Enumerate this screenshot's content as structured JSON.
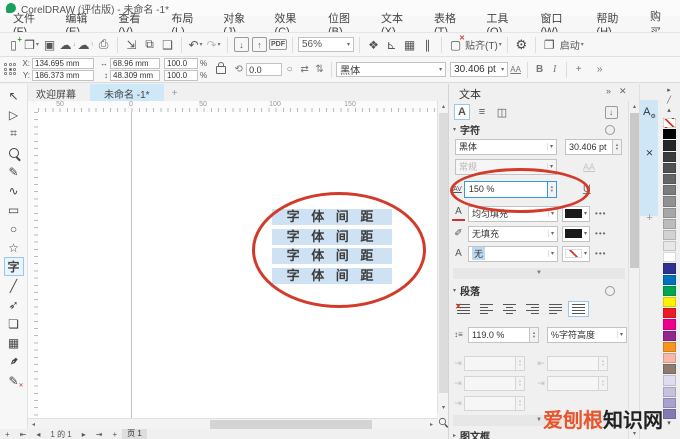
{
  "window": {
    "title": "CorelDRAW (评估版) - 未命名 -1*"
  },
  "menu": [
    "文件(F)",
    "编辑(E)",
    "查看(V)",
    "布局(L)",
    "对象(J)",
    "效果(C)",
    "位图(B)",
    "文本(X)",
    "表格(T)",
    "工具(O)",
    "窗口(W)",
    "帮助(H)",
    "购买"
  ],
  "toolbar": {
    "zoom_level": "56%",
    "snap": "贴齐(T)",
    "launch": "启动",
    "pdf": "PDF"
  },
  "propbar": {
    "x_label": "X:",
    "y_label": "Y:",
    "x_value": "134.695 mm",
    "y_value": "186.373 mm",
    "width_value": "68.96 mm",
    "height_value": "48.309 mm",
    "scale_x": "100.0",
    "scale_y": "100.0",
    "percent": "%",
    "angle_value": "0.0",
    "font_name": "黑体",
    "font_size": "30.406 pt",
    "caps": "AA",
    "bold": "B",
    "italic": "I",
    "more": "+",
    "overflow": "»"
  },
  "doc_tabs": {
    "welcome": "欢迎屏幕",
    "current": "未命名 -1*",
    "add": "+"
  },
  "ruler": {
    "marks": [
      "50",
      "0",
      "50",
      "100",
      "150"
    ]
  },
  "canvas": {
    "text_rows": [
      "字 体 间 距",
      "字 体 间 距",
      "字 体 间 距",
      "字 体 间 距"
    ]
  },
  "toolbox": [
    {
      "name": "pick-tool",
      "glyph": "↖"
    },
    {
      "name": "shape-tool",
      "glyph": "▷"
    },
    {
      "name": "crop-tool",
      "glyph": "⌗"
    },
    {
      "name": "zoom-tool",
      "glyph": "",
      "cls": "zoomtool"
    },
    {
      "name": "freehand-tool",
      "glyph": "✎"
    },
    {
      "name": "bezier-tool",
      "glyph": "∿"
    },
    {
      "name": "rectangle-tool",
      "glyph": "▭"
    },
    {
      "name": "ellipse-tool",
      "glyph": "○"
    },
    {
      "name": "polygon-tool",
      "glyph": "☆"
    },
    {
      "name": "text-tool",
      "glyph": "字",
      "cls": "active"
    },
    {
      "name": "line-tool",
      "glyph": "╱"
    },
    {
      "name": "pen-tool",
      "glyph": "➶"
    },
    {
      "name": "drop-shadow-tool",
      "glyph": "❏"
    },
    {
      "name": "mesh-fill-tool",
      "glyph": "▦"
    },
    {
      "name": "eyedropper-tool",
      "glyph": "✒",
      "cls": "rot45"
    },
    {
      "name": "outline-pen-tool",
      "glyph": "✎",
      "cls": "redx"
    }
  ],
  "docker": {
    "title": "文本",
    "char_section": "字符",
    "font_name": "黑体",
    "font_size": "30.406 pt",
    "font_style": "常规",
    "caps": "AA",
    "spacing_label": "AV",
    "char_spacing": "150 %",
    "underline": "U",
    "fill_type": "均匀填充",
    "background_fill": "无填充",
    "outline_width": "无",
    "more_dots": "•••",
    "para_section": "段落",
    "line_spacing": "119.0 %",
    "spacing_unit": "%字符高度",
    "frame_section": "图文框"
  },
  "palette": [
    {
      "name": "no-color-swatch",
      "cls": "none"
    },
    {
      "name": "swatch-black",
      "color": "#000000"
    },
    {
      "name": "swatch-gray-90",
      "color": "#262626"
    },
    {
      "name": "swatch-gray-80",
      "color": "#3b3b3b"
    },
    {
      "name": "swatch-gray-70",
      "color": "#515151"
    },
    {
      "name": "swatch-gray-60",
      "color": "#666666"
    },
    {
      "name": "swatch-gray-50",
      "color": "#7c7c7c"
    },
    {
      "name": "swatch-gray-40",
      "color": "#919191"
    },
    {
      "name": "swatch-gray-30",
      "color": "#a7a7a7"
    },
    {
      "name": "swatch-gray-20",
      "color": "#bcbcbc"
    },
    {
      "name": "swatch-gray-10",
      "color": "#d2d2d2"
    },
    {
      "name": "swatch-gray-5",
      "color": "#e7e7e7"
    },
    {
      "name": "swatch-white",
      "color": "#ffffff"
    },
    {
      "name": "swatch-navy",
      "color": "#2e3192"
    },
    {
      "name": "swatch-blue",
      "color": "#0072bc"
    },
    {
      "name": "swatch-green",
      "color": "#00a651"
    },
    {
      "name": "swatch-yellow",
      "color": "#fff200"
    },
    {
      "name": "swatch-red",
      "color": "#ed1c24"
    },
    {
      "name": "swatch-magenta",
      "color": "#ec008c"
    },
    {
      "name": "swatch-purple",
      "color": "#92278f"
    },
    {
      "name": "swatch-orange",
      "color": "#f7941d"
    },
    {
      "name": "swatch-pink",
      "color": "#f7b6a8"
    },
    {
      "name": "swatch-brown",
      "color": "#8c7b6e"
    },
    {
      "name": "swatch-lavender-light",
      "color": "#e0dcef"
    },
    {
      "name": "swatch-lavender",
      "color": "#c7c1e0"
    },
    {
      "name": "swatch-lavender-mid",
      "color": "#a9a1cf"
    },
    {
      "name": "swatch-slate-purple",
      "color": "#8579b5"
    }
  ],
  "statusbar": {
    "add": "+",
    "page_info": "1 的 1",
    "page_tab": "页 1"
  },
  "watermark": {
    "part1": "爱刨根",
    "part2": "知识网"
  }
}
